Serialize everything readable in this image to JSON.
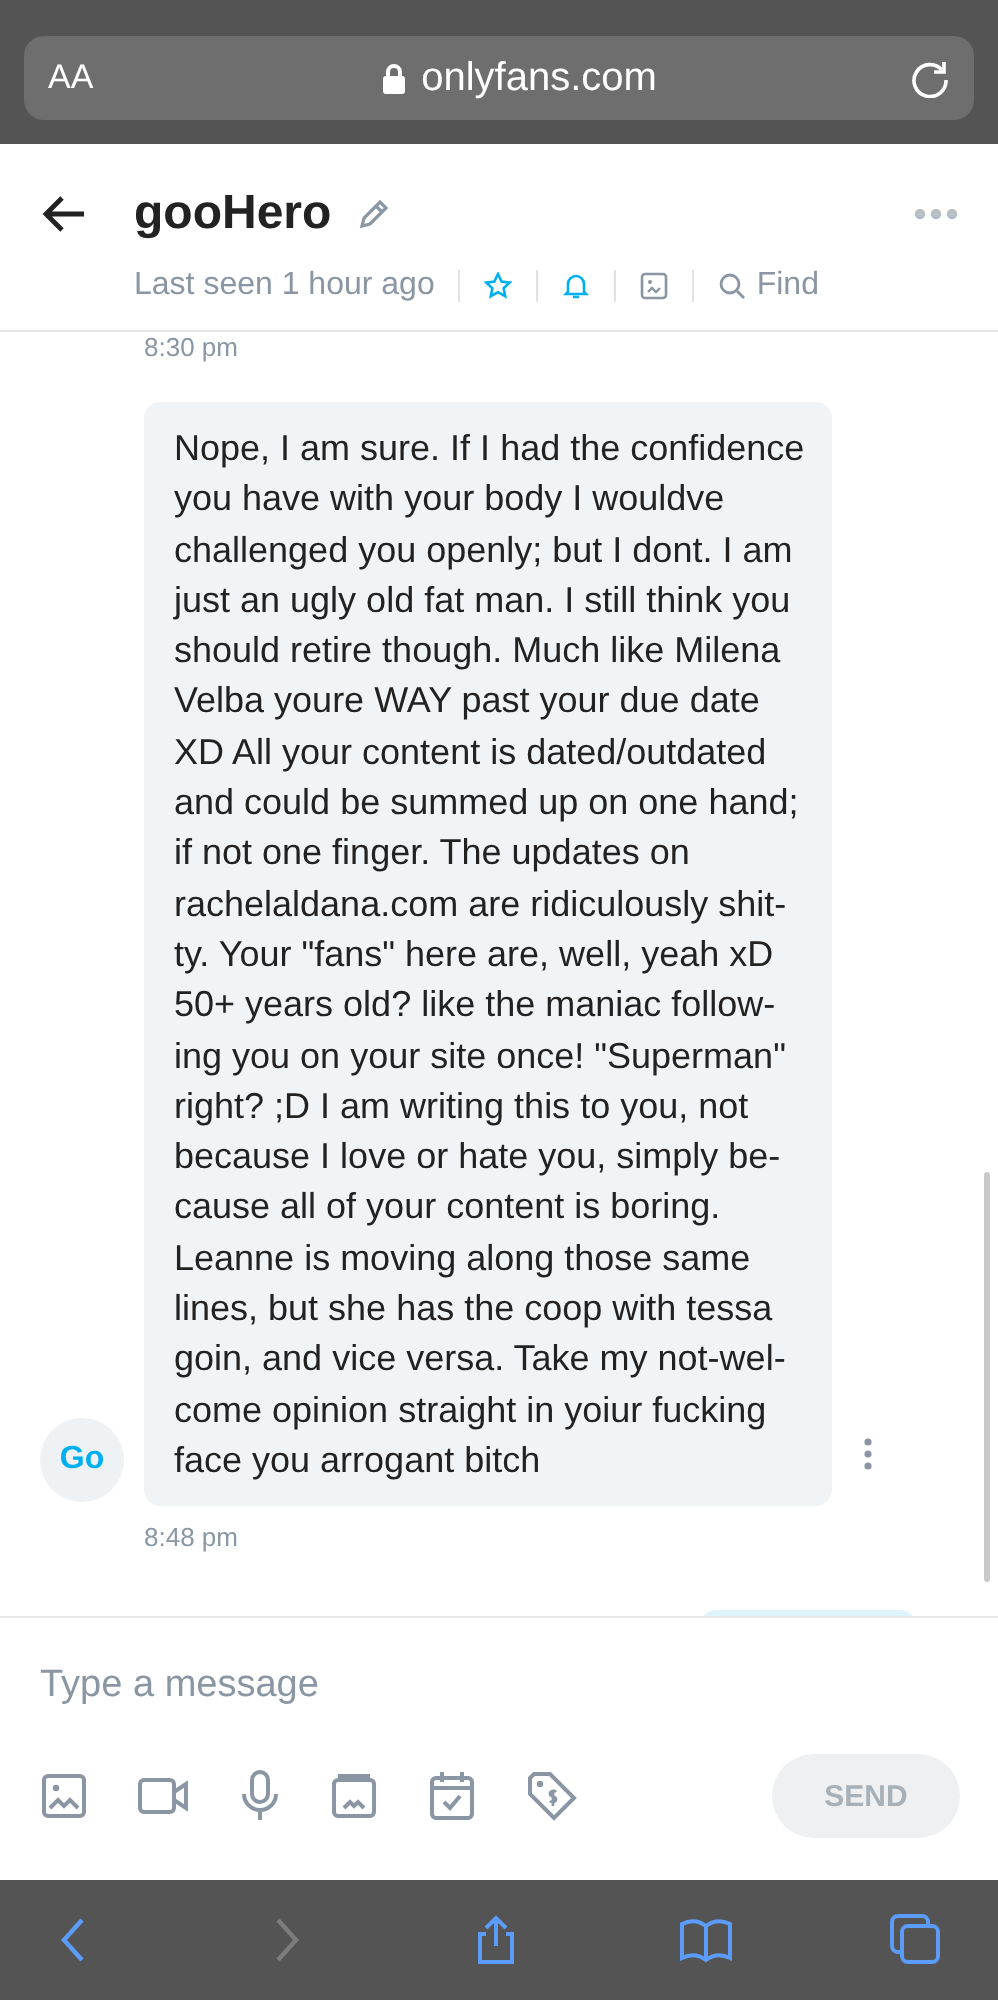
{
  "browser_bar": {
    "text_size_label": "AA",
    "url": "onlyfans.com"
  },
  "chat_header": {
    "name": "gooHero",
    "status": "Last seen 1 hour ago",
    "find_label": "Find"
  },
  "messages": [
    {
      "kind": "timestamp",
      "text": "8:30 pm"
    },
    {
      "kind": "incoming",
      "avatar": "Go",
      "lines": [
        "Nope, I am sure. If I had the confidence",
        "you have with your body I wouldve",
        "challenged you openly; but I dont. I am",
        "just an ugly old fat man. I still think you",
        "should retire though. Much like Milena",
        "Velba youre WAY past your due date",
        "XD All your content is dated/outdated",
        "and could be summed up on one hand;",
        "if not one finger. The updates on",
        "rachelaldana.com are ridiculously shit-",
        "ty. Your \"fans\" here are, well, yeah xD",
        "50+ years old? like the maniac follow-",
        "ing you on your site once! \"Superman\"",
        "right? ;D I am writing this to you, not",
        "because I love or hate you, simply be-",
        "cause all of your content is boring.",
        "Leanne is moving along those same",
        "lines, but she has the coop with tessa",
        "goin, and vice versa. Take my not-wel-",
        "come opinion straight in yoiur fucking",
        "face you arrogant bitch"
      ]
    },
    {
      "kind": "timestamp",
      "text": "8:48 pm"
    },
    {
      "kind": "outgoing"
    }
  ],
  "composer": {
    "placeholder": "Type a message",
    "send_label": "SEND",
    "send_disabled": true
  },
  "browser_toolbar": [
    {
      "kind": "back",
      "disabled": false
    },
    {
      "kind": "forward",
      "disabled": true
    },
    {
      "kind": "share",
      "disabled": false
    },
    {
      "kind": "bookmarks",
      "disabled": false
    },
    {
      "kind": "tabs",
      "disabled": false
    }
  ]
}
